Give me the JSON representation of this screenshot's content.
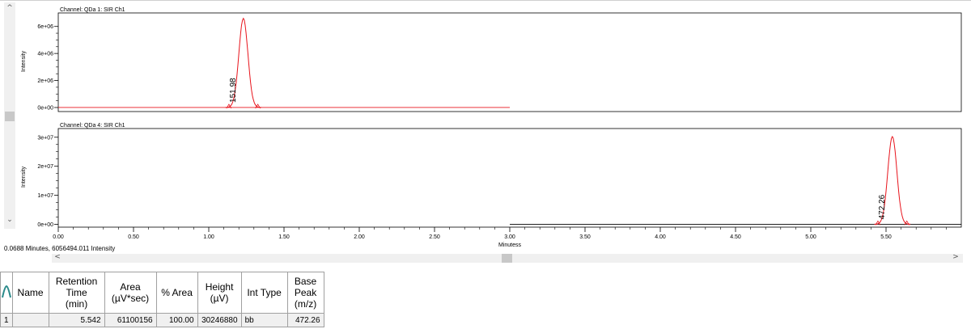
{
  "status_text": "0.0688 Minutes, 6056494.011 Intensity",
  "chart_data": [
    {
      "type": "line",
      "title": "Channel: QDa 1: SIR Ch1",
      "ylabel": "Intensity",
      "xlim": [
        0,
        6.0
      ],
      "ylim": [
        -300000,
        7000000
      ],
      "yticks": [
        {
          "v": 0,
          "label": "0e+00"
        },
        {
          "v": 2000000,
          "label": "2e+06"
        },
        {
          "v": 4000000,
          "label": "4e+06"
        },
        {
          "v": 6000000,
          "label": "6e+06"
        }
      ],
      "trace_x_range": [
        0,
        3.0
      ],
      "baseline": 0,
      "peak": {
        "rt": 1.23,
        "height": 6600000,
        "label": "151.98"
      }
    },
    {
      "type": "line",
      "title": "Channel: QDa 4: SIR Ch1",
      "ylabel": "Intensity",
      "xlabel": "Minutess",
      "xlim": [
        0,
        6.0
      ],
      "ylim": [
        -1000000,
        33000000
      ],
      "yticks": [
        {
          "v": 0,
          "label": "0e+00"
        },
        {
          "v": 10000000,
          "label": "1e+07"
        },
        {
          "v": 20000000,
          "label": "2e+07"
        },
        {
          "v": 30000000,
          "label": "3e+07"
        }
      ],
      "xticks": [
        "0.00",
        "0.50",
        "1.00",
        "1.50",
        "2.00",
        "2.50",
        "3.00",
        "3.50",
        "4.00",
        "4.50",
        "5.00",
        "5.50"
      ],
      "trace_x_range": [
        3.0,
        6.0
      ],
      "baseline": 0,
      "peak": {
        "rt": 5.542,
        "height": 30246880,
        "label": "472.26"
      }
    }
  ],
  "colors": {
    "trace": "#e8141c",
    "axis": "#000000"
  },
  "table": {
    "headers": [
      "Name",
      "Retention\nTime\n(min)",
      "Area\n(µV*sec)",
      "% Area",
      "Height\n(µV)",
      "Int Type",
      "Base\nPeak\n(m/z)"
    ],
    "rows": [
      {
        "index": "1",
        "name": "",
        "rt": "5.542",
        "area": "61100156",
        "pct_area": "100.00",
        "height": "30246880",
        "int_type": "bb",
        "base_peak": "472.26"
      }
    ]
  }
}
